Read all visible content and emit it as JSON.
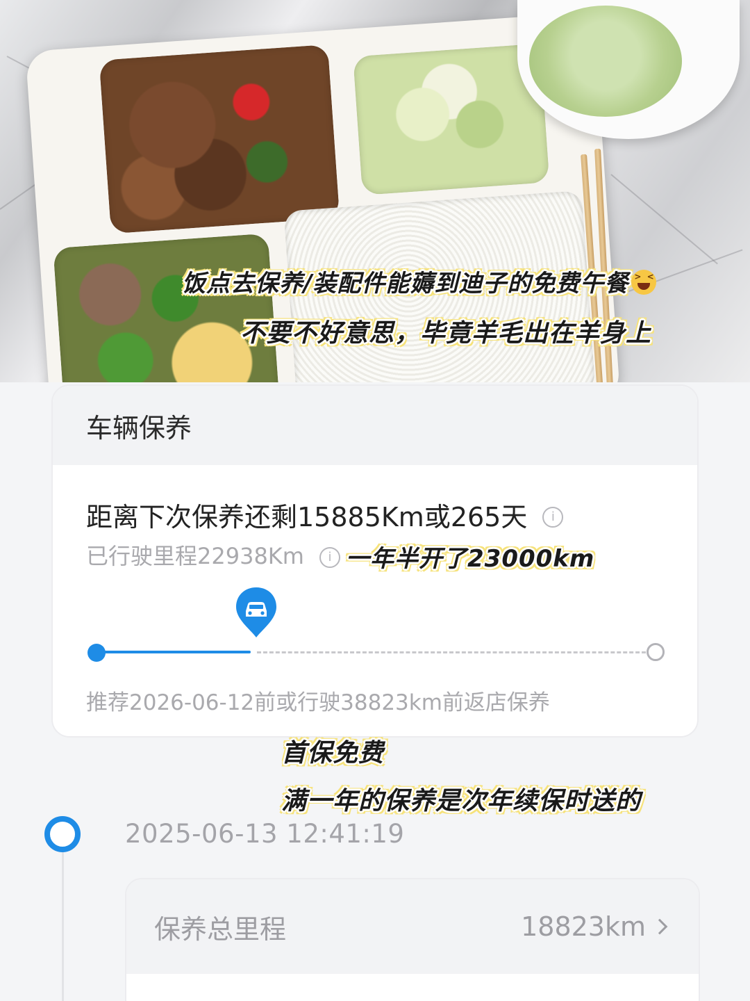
{
  "overlays": {
    "line1": "饭点去保养/装配件能薅到迪子的免费午餐",
    "line2": "不要不好意思，毕竟羊毛出在羊身上",
    "line3": "一年半开了23000km",
    "line4": "首保免费",
    "line5": "满一年的保养是次年续保时送的"
  },
  "maintenance_card": {
    "title": "车辆保养",
    "remaining": "距离下次保养还剩15885Km或265天",
    "info_icon": "i",
    "driven": "已行驶里程22938Km",
    "recommendation": "推荐2026-06-12前或行驶38823km前返店保养",
    "progress_fraction": 0.28
  },
  "timeline": {
    "entry_time": "2025-06-13 12:41:19",
    "detail_label": "保养总里程",
    "detail_value": "18823km"
  },
  "colors": {
    "accent": "#1e8ce6",
    "muted_text": "#a9a9ad",
    "header_bg": "#f2f3f5"
  },
  "icons": {
    "car_pin": "car-location-pin-icon",
    "info": "info-icon",
    "chevron": "chevron-right-icon",
    "emoji": "grinning-squint-emoji-icon"
  }
}
